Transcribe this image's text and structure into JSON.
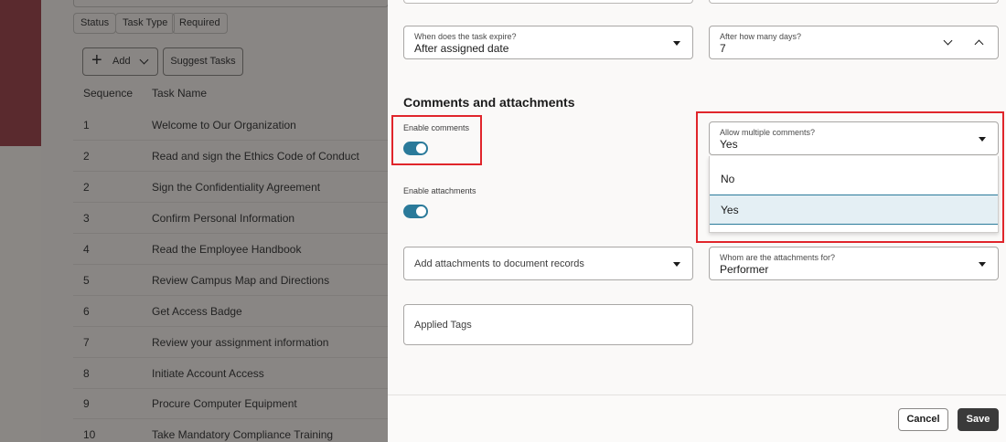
{
  "background": {
    "filters": [
      "Status",
      "Task Type",
      "Required"
    ],
    "add_label": "Add",
    "suggest_label": "Suggest Tasks",
    "columns": [
      "Sequence",
      "Task Name"
    ],
    "rows": [
      {
        "seq": "1",
        "name": "Welcome to Our Organization"
      },
      {
        "seq": "2",
        "name": "Read and sign the Ethics Code of Conduct"
      },
      {
        "seq": "2",
        "name": "Sign the Confidentiality Agreement"
      },
      {
        "seq": "3",
        "name": "Confirm Personal Information"
      },
      {
        "seq": "4",
        "name": "Read the Employee Handbook"
      },
      {
        "seq": "5",
        "name": "Review Campus Map and Directions"
      },
      {
        "seq": "6",
        "name": "Get Access Badge"
      },
      {
        "seq": "7",
        "name": "Review your assignment information"
      },
      {
        "seq": "8",
        "name": "Initiate Account Access"
      },
      {
        "seq": "9",
        "name": "Procure Computer Equipment"
      },
      {
        "seq": "10",
        "name": "Take Mandatory Compliance Training"
      }
    ]
  },
  "drawer": {
    "expire": {
      "label": "When does the task expire?",
      "value": "After assigned date"
    },
    "days": {
      "label": "After how many days?",
      "value": "7"
    },
    "section_title": "Comments and attachments",
    "enable_comments": {
      "label": "Enable comments",
      "on": true
    },
    "enable_attachments": {
      "label": "Enable attachments",
      "on": true
    },
    "multiple_comments": {
      "label": "Allow multiple comments?",
      "value": "Yes",
      "options": [
        "No",
        "Yes"
      ],
      "selected": "Yes"
    },
    "doc_records": {
      "placeholder": "Add attachments to document records"
    },
    "attachments_for": {
      "label": "Whom are the attachments for?",
      "value": "Performer"
    },
    "applied_tags": {
      "placeholder": "Applied Tags"
    },
    "cancel_label": "Cancel",
    "save_label": "Save"
  },
  "colors": {
    "toggle_on": "#2a7a9a",
    "highlight_box": "#e0252b",
    "save_bg": "#3a3a3a"
  }
}
